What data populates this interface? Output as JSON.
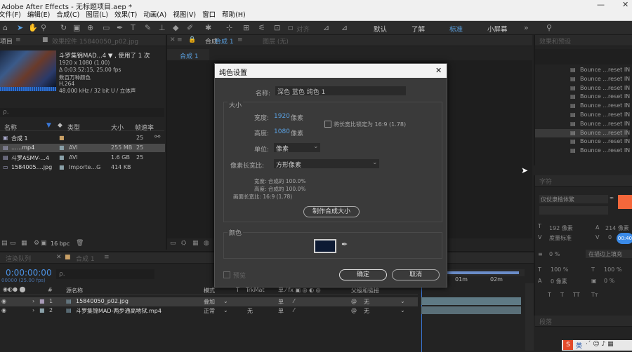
{
  "title_bar": {
    "title": "Adobe After Effects - 无标题项目.aep *",
    "minimize": "—",
    "close": "✕"
  },
  "menu": [
    "文件(F)",
    "编辑(E)",
    "合成(C)",
    "图层(L)",
    "效果(T)",
    "动画(A)",
    "视图(V)",
    "窗口",
    "帮助(H)"
  ],
  "toolbar": {
    "align_label": "对齐",
    "workspaces": [
      "默认",
      "了解",
      "标准",
      "小屏幕"
    ],
    "active_workspace": "标准"
  },
  "project_panel": {
    "tab_project": "项目",
    "tab_effects": "效果控件 15840050_p02.jpg",
    "preview": {
      "name": "斗罗集锦MAD...4 ▼ , 使用了 1 次",
      "lines": [
        "1920 x 1080 (1.00)",
        "Δ 0:03:52:15, 25.00 fps",
        "数百万种颜色",
        "H.264",
        "48.000 kHz / 32 bit U / 立体声"
      ]
    },
    "search_placeholder": "ρ.",
    "columns": {
      "name": "名称",
      "type": "类型",
      "size": "大小",
      "fps": "帧速率"
    },
    "items": [
      {
        "name": "合成 1",
        "type": "",
        "size": "",
        "fps": "25"
      },
      {
        "name": "......mp4",
        "type": "AVI",
        "size": "255 MB",
        "fps": "25"
      },
      {
        "name": "斗罗ASMV-...4",
        "type": "AVI",
        "size": "1.6 GB",
        "fps": "25"
      },
      {
        "name": "1584005....jpg",
        "type": "Importe...G",
        "size": "414 KB",
        "fps": ""
      }
    ],
    "bpc": "16 bpc"
  },
  "composition_panel": {
    "lock_label": "合成",
    "tab": "合成 1",
    "layer_label": "图层 (无)",
    "subtab": "合成 1"
  },
  "effects_panel": {
    "title": "效果和预设",
    "items": [
      "Bounce ...reset IN",
      "Bounce ...reset IN",
      "Bounce ...reset IN",
      "Bounce ...reset IN",
      "Bounce ...reset IN",
      "Bounce ...reset IN",
      "Bounce ...reset IN",
      "Bounce ...reset IN",
      "Bounce ...reset IN",
      "Bounce ...reset IN"
    ]
  },
  "char_panel": {
    "title": "字符",
    "font": "仪仗隶楷体繁",
    "size": "192 像素",
    "size2": "214 像素",
    "metrics": "度量标准",
    "leading": "0",
    "hscale": "100 %",
    "vscale": "100 %",
    "tsume": "0 像素",
    "tsume2": "0 %",
    "edge": "在描边上填充",
    "paragraph": "段落",
    "badge": "00:40"
  },
  "timeline": {
    "tab_queue": "渲染队列",
    "tab_comp": "合成 1",
    "timecode": "0:00:00:00",
    "fps_note": "00000 (25.00 fps)",
    "search_placeholder": "ρ.",
    "columns": {
      "num": "#",
      "source": "源名称",
      "mode": "模式",
      "t": "T",
      "trkmat": "TrkMat",
      "parent": "父级和链接"
    },
    "layers": [
      {
        "num": "1",
        "name": "15840050_p02.jpg",
        "mode": "叠加",
        "trkmat": "",
        "parent": "无"
      },
      {
        "num": "2",
        "name": "斗罗集锦MAD-两步通高地狱.mp4",
        "mode": "正常",
        "trkmat": "无",
        "parent": "无"
      }
    ],
    "ruler": [
      "01m",
      "02m"
    ]
  },
  "dialog": {
    "title": "纯色设置",
    "close": "✕",
    "name_label": "名称:",
    "name_value": "深色 蓝色 纯色 1",
    "size_section": "大小",
    "width_label": "宽度:",
    "width_value": "1920",
    "width_unit": "像素",
    "height_label": "高度:",
    "height_value": "1080",
    "height_unit": "像素",
    "lock_label": "将长宽比锁定为 16:9 (1.78)",
    "unit_label": "单位:",
    "unit_value": "像素",
    "par_label": "像素长宽比:",
    "par_value": "方形像素",
    "info_width": "宽度: 合成的 100.0%",
    "info_height": "高度: 合成的 100.0%",
    "info_aspect": "画面长宽比: 16:9 (1.78)",
    "make_comp_size": "制作合成大小",
    "color_section": "颜色",
    "color_value": "#0d1a33",
    "preview_label": "预览",
    "ok": "确定",
    "cancel": "取消"
  },
  "taskbar": {
    "ime": "英",
    "icons": "·ˊ ☺ ♪ ▦"
  }
}
